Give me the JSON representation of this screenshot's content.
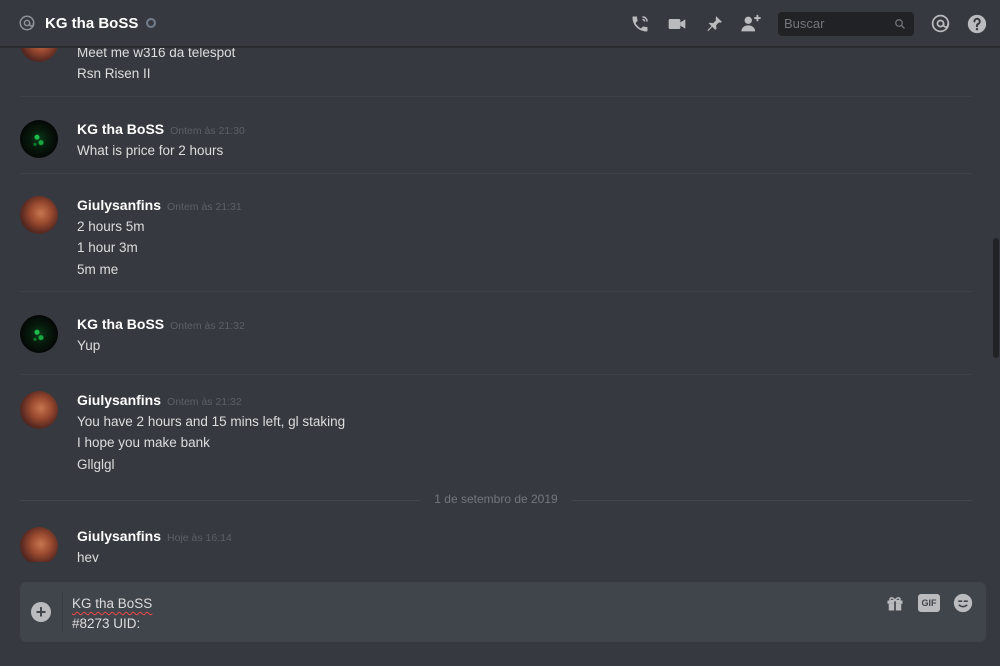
{
  "header": {
    "channel_name": "KG tha BoSS",
    "search_placeholder": "Buscar",
    "icons": [
      "at-icon",
      "call-icon",
      "video-icon",
      "pin-icon",
      "add-friend-icon",
      "search-icon",
      "mention-icon",
      "help-icon"
    ]
  },
  "messages": [
    {
      "lines": [
        "Meet me w316 da telespot",
        "Rsn Risen II"
      ]
    },
    {
      "author": "KG tha BoSS",
      "timestamp": "Ontem às 21:30",
      "lines": [
        "What is price for 2 hours"
      ]
    },
    {
      "author": "Giulysanfins",
      "timestamp": "Ontem às 21:31",
      "lines": [
        "2 hours 5m",
        "1 hour 3m",
        "5m me"
      ]
    },
    {
      "author": "KG tha BoSS",
      "timestamp": "Ontem às 21:32",
      "lines": [
        "Yup"
      ]
    },
    {
      "author": "Giulysanfins",
      "timestamp": "Ontem às 21:32",
      "lines": [
        "You have 2 hours and 15 mins left, gl staking",
        "I hope you make bank",
        "Gllglgl"
      ]
    },
    {
      "author": "Giulysanfins",
      "timestamp": "Hoje às 16:14",
      "lines": [
        "hey"
      ]
    }
  ],
  "date_separator": "1 de setembro de 2019",
  "composer": {
    "line1": "KG tha BoSS",
    "line2": "#8273 UID:",
    "icons": [
      "plus-icon",
      "gift-icon",
      "gif-icon",
      "emoji-icon"
    ]
  },
  "colors": {
    "background": "#36393f",
    "header_bg": "#36393f",
    "input_bg": "#40444b",
    "search_bg": "#202225",
    "text": "#dcddde",
    "username": "#ffffff",
    "timestamp": "#5d6066",
    "icon": "#b9bbbe"
  }
}
